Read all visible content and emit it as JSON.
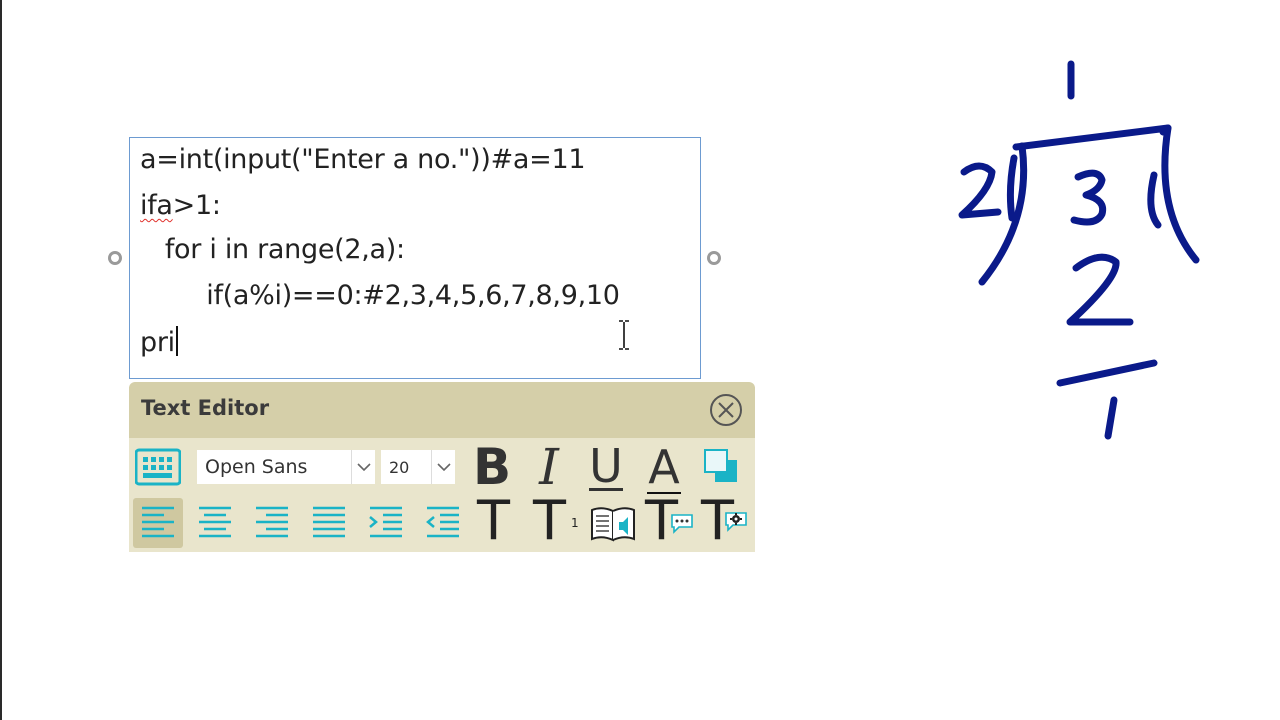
{
  "code_lines": [
    "a=int(input(\"Enter a no.\"))#a=11",
    "ifa",
    ">1:",
    "   for i in range(2,a):",
    "        if(a%i)==0:#2,3,4,5,6,7,8,9,10",
    "pri"
  ],
  "editor": {
    "title": "Text Editor",
    "font_value": "Open Sans",
    "size_value": "20",
    "bold_label": "B",
    "italic_label": "I",
    "underline_label": "U",
    "color_label": "A",
    "subscript_label": "T",
    "subscript_mark": "1",
    "superscript_label": "T",
    "superscript_mark": "1",
    "tts_label": "T",
    "settings_label": "T"
  },
  "handwriting": {
    "numbers": [
      "1",
      "2",
      "3",
      "2",
      "1"
    ]
  },
  "colors": {
    "accent": "#1ab3c6",
    "ink": "#0a1a8a",
    "panel": "#e9e5cc",
    "panel_header": "#d5cfa9"
  }
}
